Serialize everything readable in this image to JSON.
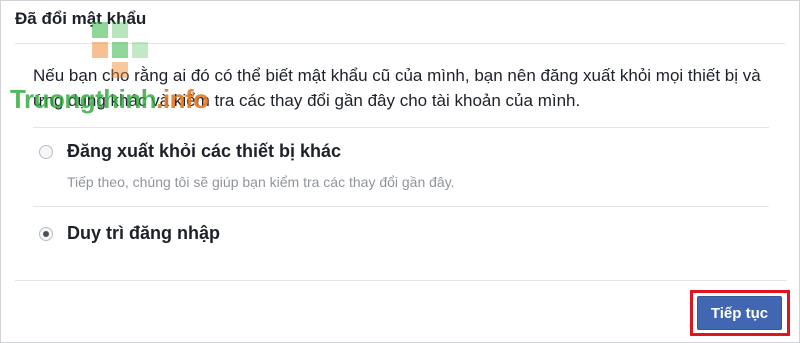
{
  "dialog": {
    "title": "Đã đổi mật khẩu",
    "description": "Nếu bạn cho rằng ai đó có thể biết mật khẩu cũ của mình, bạn nên đăng xuất khỏi mọi thiết bị và ứng dụng khác và kiểm tra các thay đổi gần đây cho tài khoản của mình."
  },
  "options": [
    {
      "label": "Đăng xuất khỏi các thiết bị khác",
      "sublabel": "Tiếp theo, chúng tôi sẽ giúp bạn kiểm tra các thay đổi gần đây.",
      "selected": false
    },
    {
      "label": "Duy trì đăng nhập",
      "selected": true
    }
  ],
  "footer": {
    "continue_label": "Tiếp tục"
  },
  "watermark": {
    "name": "Truongthinh",
    "domain": ".info"
  },
  "colors": {
    "button": "#4267b2",
    "highlight": "#e0141e"
  }
}
